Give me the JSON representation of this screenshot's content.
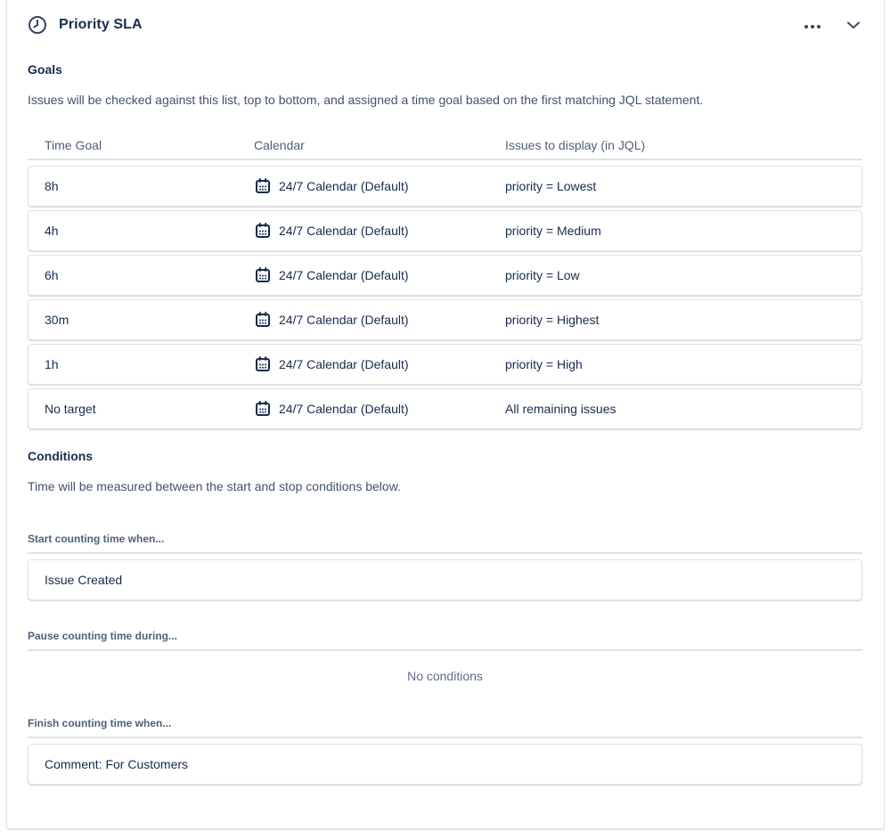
{
  "header": {
    "title": "Priority SLA",
    "icons": {
      "title_icon": "clock-icon",
      "more_icon": "ellipsis-icon",
      "collapse_icon": "chevron-down-icon"
    }
  },
  "goals": {
    "heading": "Goals",
    "description": "Issues will be checked against this list, top to bottom, and assigned a time goal based on the first matching JQL statement.",
    "table": {
      "columns": [
        "Time Goal",
        "Calendar",
        "Issues to display (in JQL)"
      ],
      "calendar_icon": "calendar-icon",
      "rows": [
        {
          "time_goal": "8h",
          "calendar": "24/7 Calendar (Default)",
          "jql": "priority = Lowest"
        },
        {
          "time_goal": "4h",
          "calendar": "24/7 Calendar (Default)",
          "jql": "priority = Medium"
        },
        {
          "time_goal": "6h",
          "calendar": "24/7 Calendar (Default)",
          "jql": "priority = Low"
        },
        {
          "time_goal": "30m",
          "calendar": "24/7 Calendar (Default)",
          "jql": "priority = Highest"
        },
        {
          "time_goal": "1h",
          "calendar": "24/7 Calendar (Default)",
          "jql": "priority = High"
        },
        {
          "time_goal": "No target",
          "calendar": "24/7 Calendar (Default)",
          "jql": "All remaining issues"
        }
      ]
    }
  },
  "conditions": {
    "heading": "Conditions",
    "description": "Time will be measured between the start and stop conditions below.",
    "start": {
      "label": "Start counting time when...",
      "value": "Issue Created"
    },
    "pause": {
      "label": "Pause counting time during...",
      "empty_text": "No conditions"
    },
    "finish": {
      "label": "Finish counting time when...",
      "value": "Comment: For Customers"
    }
  },
  "colors": {
    "text_primary": "#172B4D",
    "text_secondary": "#42526E",
    "text_muted": "#5E6C84",
    "border": "#DFE1E6",
    "icon": "#344563"
  }
}
